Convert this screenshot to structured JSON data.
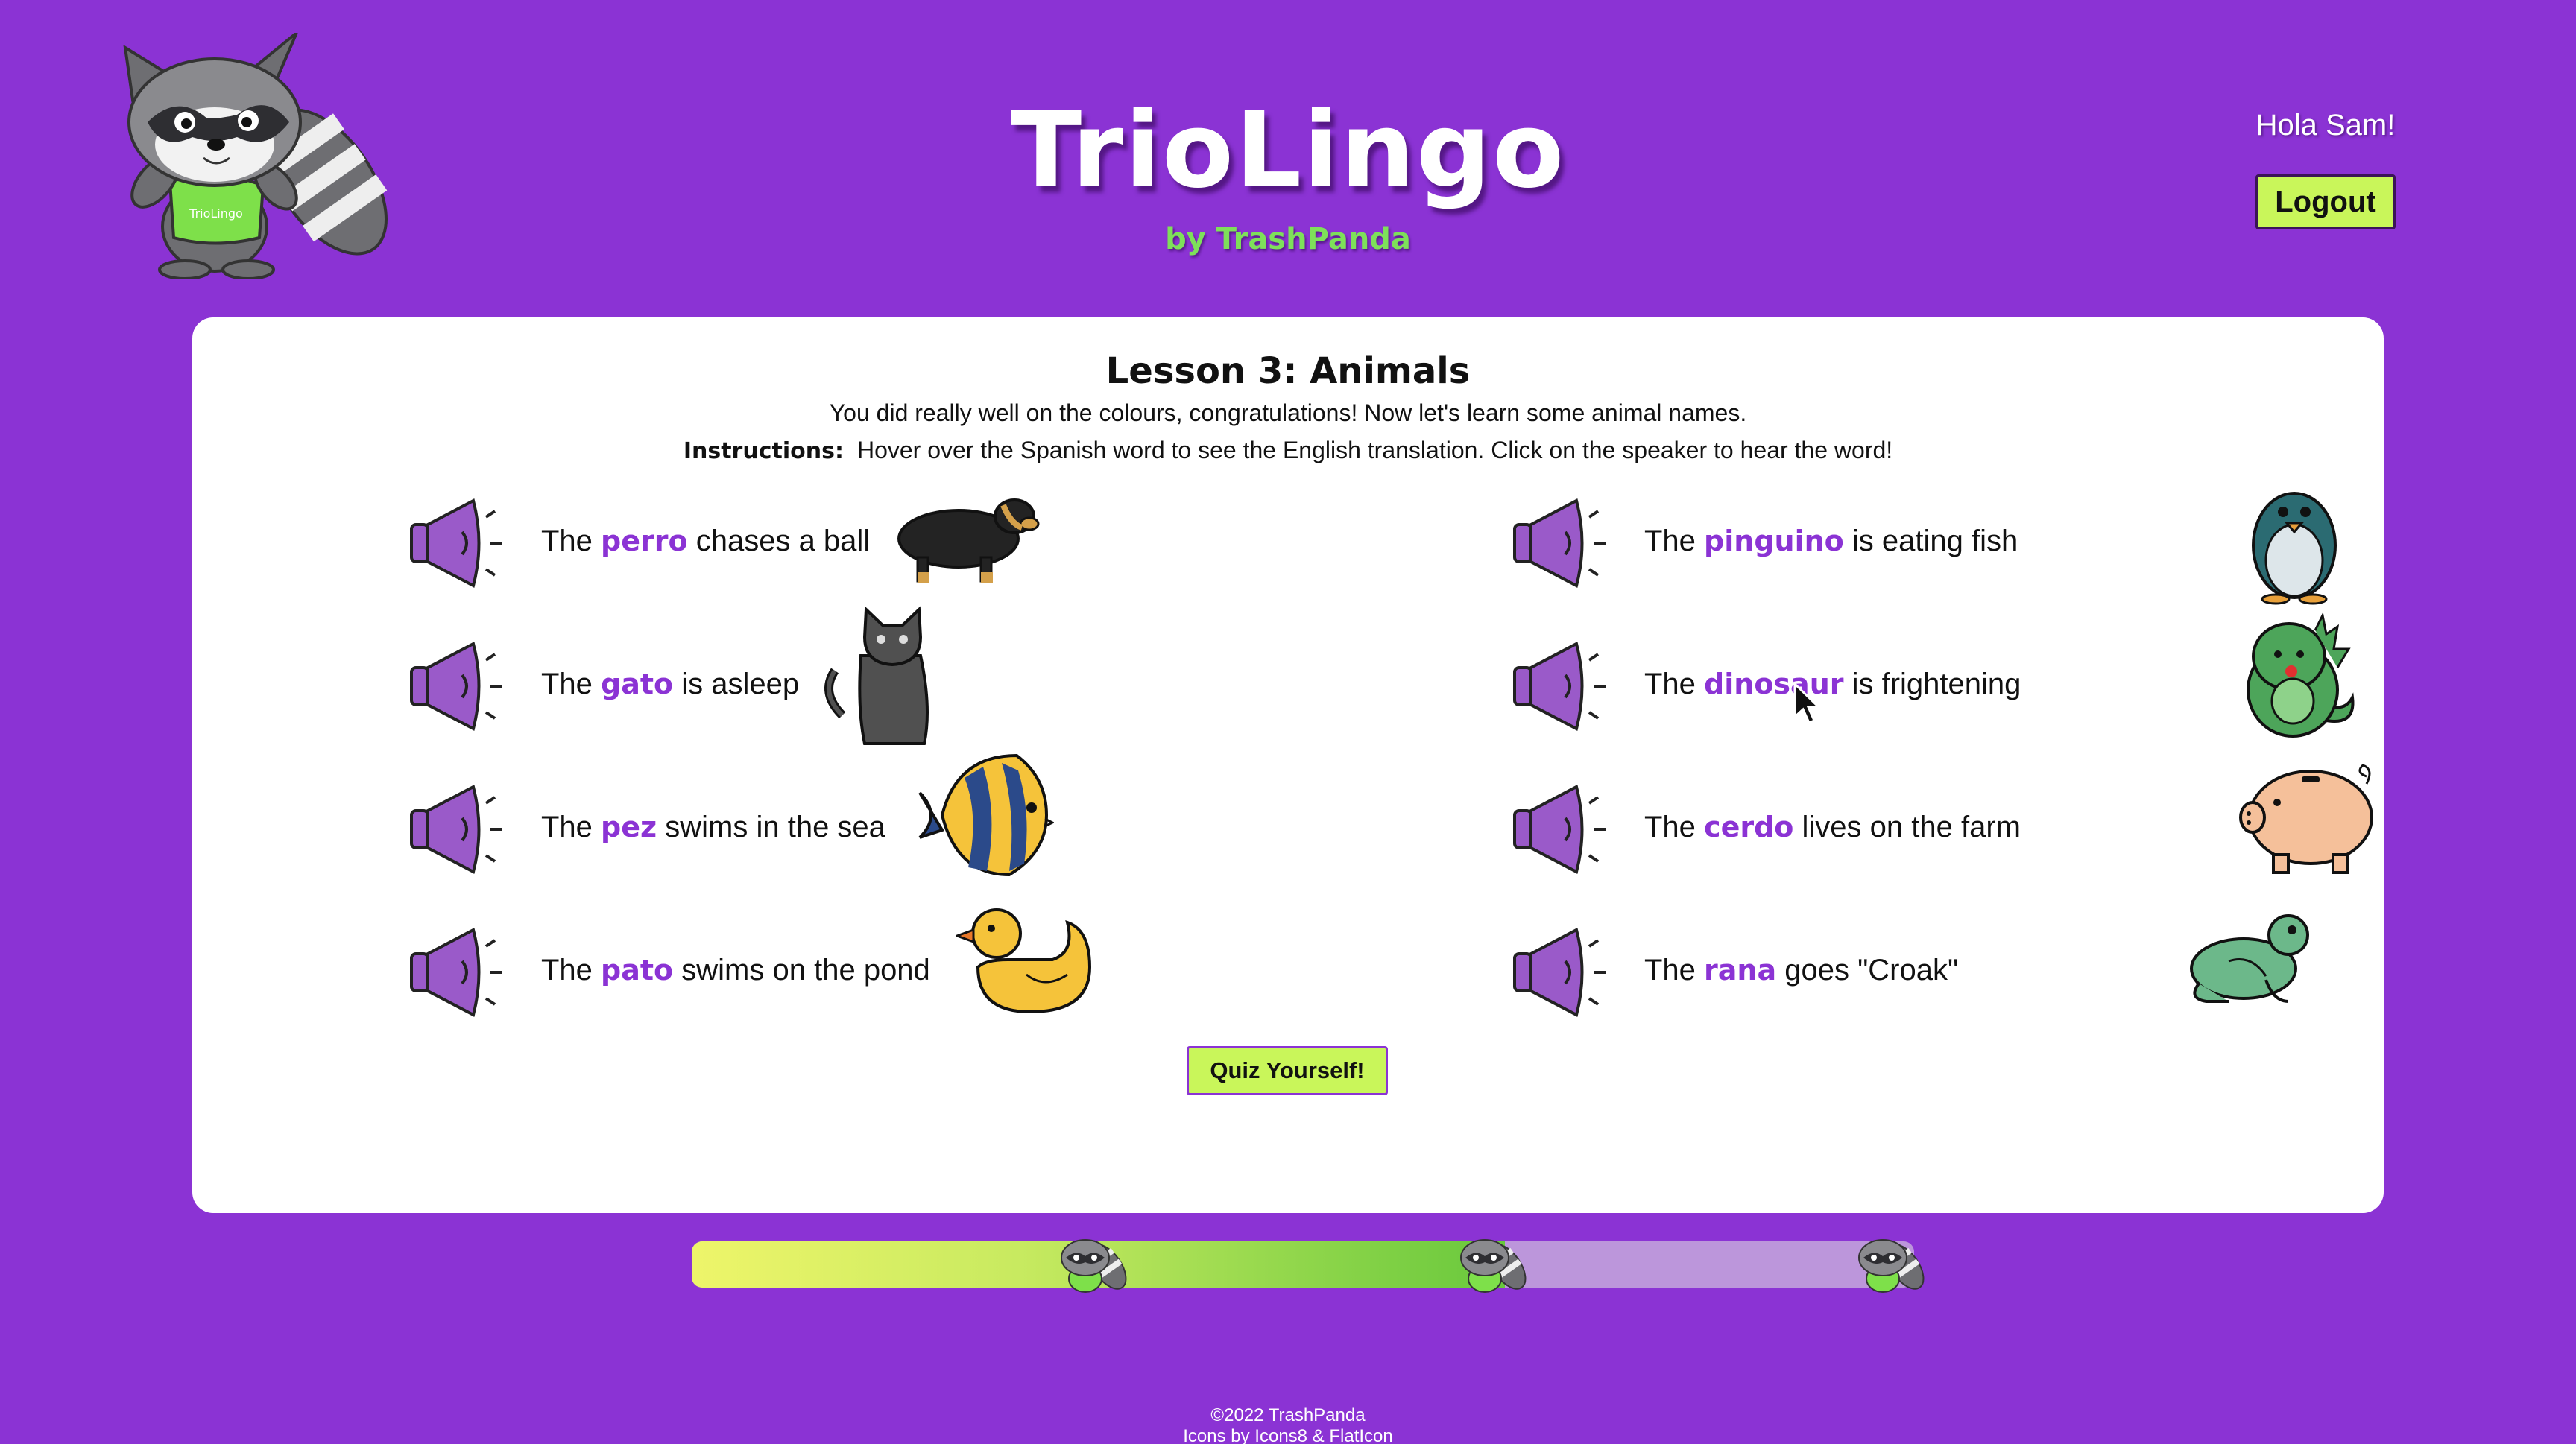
{
  "app": {
    "title": "TrioLingo",
    "subtitle": "by TrashPanda",
    "mascot_text": "TrioLingo"
  },
  "user": {
    "greeting": "Hola Sam!",
    "logout_label": "Logout"
  },
  "lesson": {
    "title": "Lesson 3: Animals",
    "intro": "You did really well on the colours, congratulations! Now let's learn some animal names.",
    "instructions_label": "Instructions:",
    "instructions_text": "Hover over the Spanish word to see the English translation. Click on the speaker to hear the word!",
    "items": [
      {
        "before": "The ",
        "word": "perro",
        "after": " chases a ball",
        "animal": "dog-icon"
      },
      {
        "before": "The ",
        "word": "pinguino",
        "after": " is eating fish",
        "animal": "penguin-icon"
      },
      {
        "before": "The ",
        "word": "gato",
        "after": " is asleep",
        "animal": "cat-icon"
      },
      {
        "before": "The ",
        "word": "dinosaur",
        "after": " is frightening",
        "animal": "dinosaur-icon"
      },
      {
        "before": "The ",
        "word": "pez",
        "after": " swims in the sea",
        "animal": "fish-icon"
      },
      {
        "before": "The ",
        "word": "cerdo",
        "after": " lives on the farm",
        "animal": "pig-icon"
      },
      {
        "before": "The ",
        "word": "pato",
        "after": " swims on the pond",
        "animal": "duck-icon"
      },
      {
        "before": "The ",
        "word": "rana",
        "after": " goes \"Croak\"",
        "animal": "frog-icon"
      }
    ],
    "quiz_label": "Quiz Yourself!"
  },
  "progress": {
    "fraction": 0.665,
    "milestones": 3
  },
  "footer": {
    "copyright": "©2022 TrashPanda",
    "credits": "Icons by Icons8 & FlatIcon"
  },
  "colors": {
    "background": "#8b33d4",
    "accent": "#c9f65a",
    "word": "#8b33d4",
    "brand_sub": "#7ee05a"
  }
}
